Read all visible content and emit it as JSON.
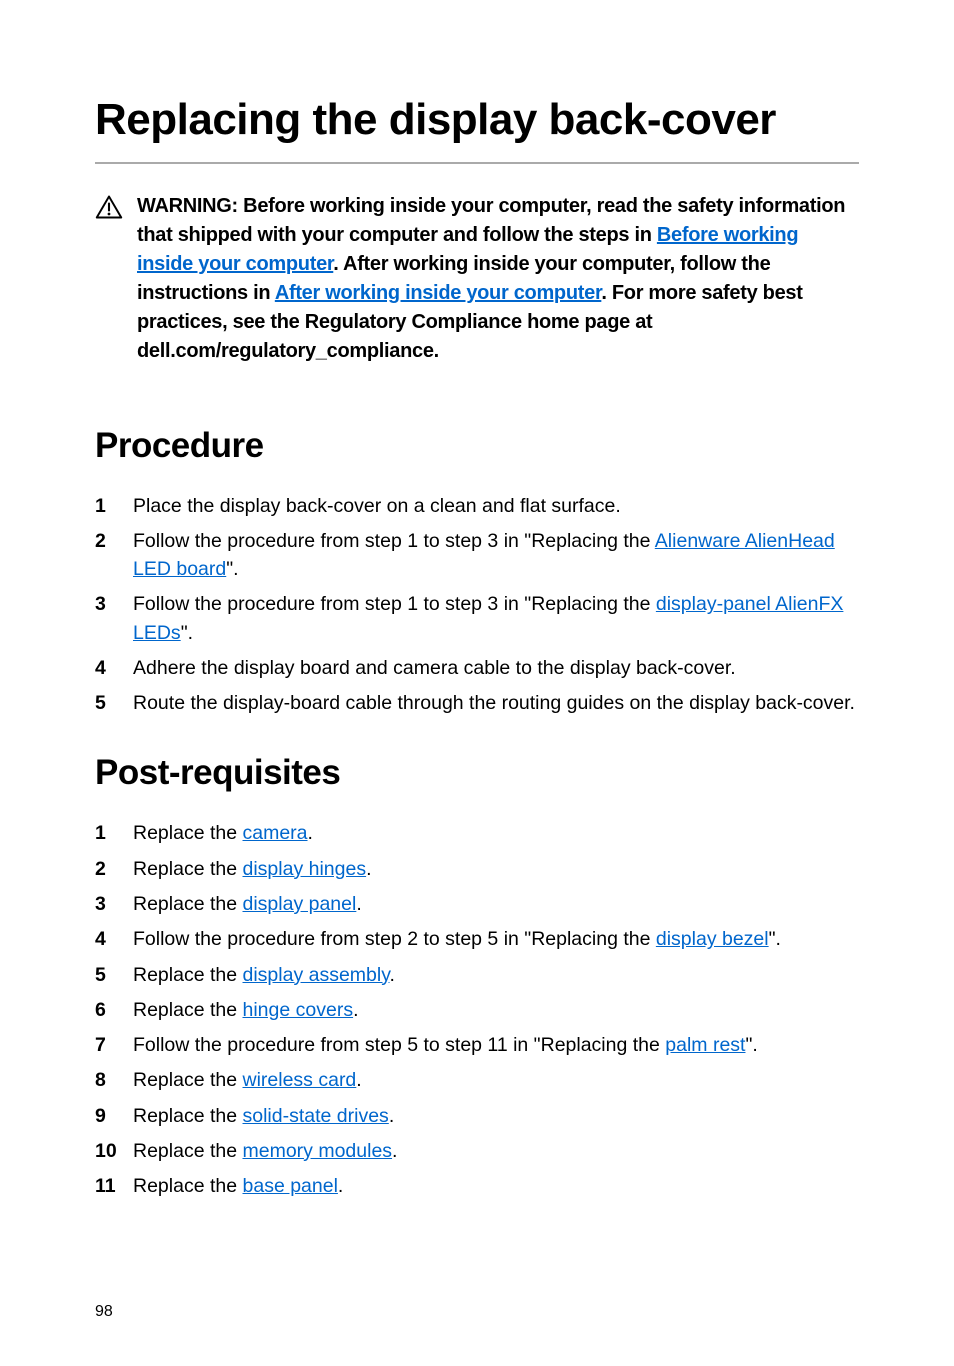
{
  "page": {
    "title": "Replacing the display back-cover",
    "page_number": "98"
  },
  "warning": {
    "prefix": "WARNING: Before working inside your computer, read the safety information that shipped with your computer and follow the steps in ",
    "link1": "Before working inside your computer",
    "mid1": ". After working inside your computer, follow the instructions in ",
    "link2": "After working inside your computer",
    "suffix": ". For more safety best practices, see the Regulatory Compliance home page at dell.com/regulatory_compliance."
  },
  "procedure": {
    "heading": "Procedure",
    "items": [
      {
        "pre": "Place the display back-cover on a clean and flat surface."
      },
      {
        "pre": "Follow the procedure from step 1 to step 3 in \"Replacing the ",
        "link": "Alienware AlienHead LED board",
        "post": "\"."
      },
      {
        "pre": "Follow the procedure from step 1 to step 3 in \"Replacing the ",
        "link": "display-panel AlienFX LEDs",
        "post": "\"."
      },
      {
        "pre": "Adhere the display board and camera cable to the display back-cover."
      },
      {
        "pre": "Route the display-board cable through the routing guides on the display back-cover."
      }
    ]
  },
  "postreq": {
    "heading": "Post-requisites",
    "items": [
      {
        "pre": "Replace the ",
        "link": "camera",
        "post": "."
      },
      {
        "pre": "Replace the ",
        "link": "display hinges",
        "post": "."
      },
      {
        "pre": "Replace the ",
        "link": "display panel",
        "post": "."
      },
      {
        "pre": "Follow the procedure from step 2 to step 5 in \"Replacing the ",
        "link": "display bezel",
        "post": "\"."
      },
      {
        "pre": "Replace the ",
        "link": "display assembly",
        "post": "."
      },
      {
        "pre": "Replace the ",
        "link": "hinge covers",
        "post": "."
      },
      {
        "pre": "Follow the procedure from step 5 to step 11 in \"Replacing the ",
        "link": "palm rest",
        "post": "\"."
      },
      {
        "pre": "Replace the ",
        "link": "wireless card",
        "post": "."
      },
      {
        "pre": "Replace the ",
        "link": "solid-state drives",
        "post": "."
      },
      {
        "pre": "Replace the ",
        "link": "memory modules",
        "post": "."
      },
      {
        "pre": "Replace the ",
        "link": "base panel",
        "post": "."
      }
    ]
  }
}
